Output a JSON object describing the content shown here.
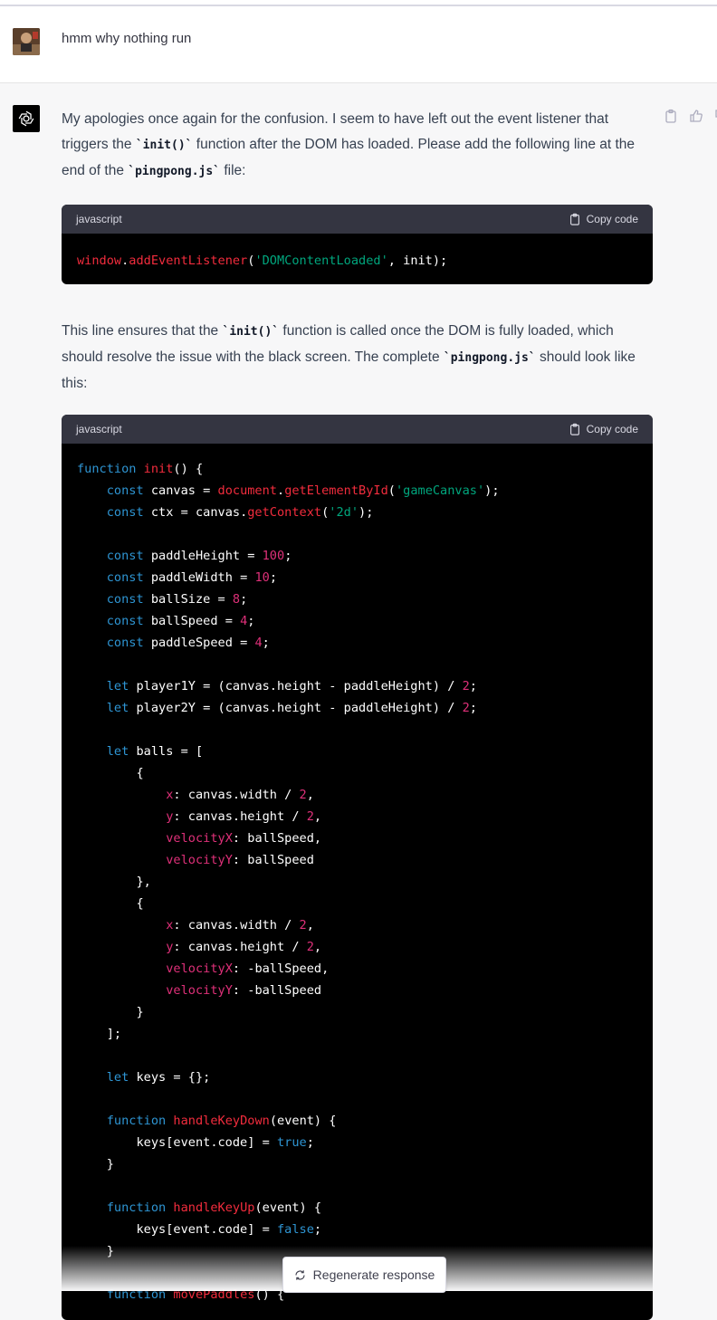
{
  "user": {
    "message": "hmm why nothing run"
  },
  "assistant": {
    "para1": {
      "a": "My apologies once again for the confusion. I seem to have left out the event listener that triggers the ",
      "code1": "`init()`",
      "b": " function after the DOM has loaded. Please add the following line at the end of the ",
      "code2": "`pingpong.js`",
      "c": " file:"
    },
    "code1": {
      "lang": "javascript",
      "copy_label": "Copy code"
    },
    "para2": {
      "a": "This line ensures that the ",
      "code1": "`init()`",
      "b": " function is called once the DOM is fully loaded, which should resolve the issue with the black screen. The complete ",
      "code2": "`pingpong.js`",
      "c": " should look like this:"
    },
    "code2": {
      "lang": "javascript",
      "copy_label": "Copy code"
    }
  },
  "regenerate_label": "Regenerate response",
  "icons": [
    "user-avatar",
    "chatgpt-logo-icon",
    "clipboard-icon",
    "thumbs-up-icon",
    "thumbs-down-icon",
    "clipboard-icon",
    "refresh-icon"
  ]
}
